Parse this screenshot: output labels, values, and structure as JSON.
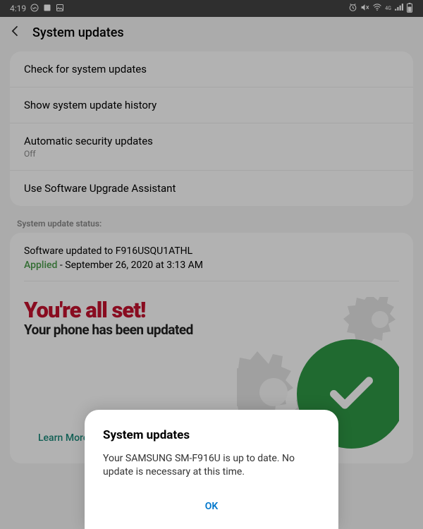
{
  "status_bar": {
    "time": "4:19"
  },
  "header": {
    "title": "System updates"
  },
  "menu": {
    "check": "Check for system updates",
    "history": "Show system update history",
    "auto": "Automatic security updates",
    "auto_sub": "Off",
    "assistant": "Use Software Upgrade Assistant"
  },
  "section_label": "System update status:",
  "update_status": {
    "software_line": "Software updated to F916USQU1ATHL",
    "applied_label": "Applied",
    "applied_rest": " - September 26, 2020 at 3:13 AM"
  },
  "banner": {
    "title": "You're all set!",
    "subtitle": "Your phone has been updated",
    "learn_more": "Learn More"
  },
  "dialog": {
    "title": "System updates",
    "body": "Your SAMSUNG SM-F916U is up to date. No update is necessary at this time.",
    "ok": "OK"
  }
}
